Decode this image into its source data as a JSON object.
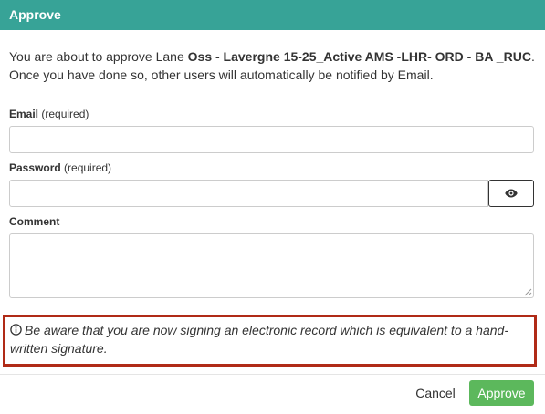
{
  "dialog": {
    "title": "Approve",
    "intro": {
      "before": "You are about to approve Lane ",
      "lane": "Oss - Lavergne 15-25_Active AMS -LHR- ORD - BA _RUC",
      "after": ". Once you have done so, other users will automatically be notified by Email."
    },
    "email": {
      "label": "Email",
      "hint": " (required)",
      "value": "",
      "placeholder": ""
    },
    "password": {
      "label": "Password",
      "hint": " (required)",
      "value": "",
      "placeholder": "",
      "toggle_icon": "eye-icon"
    },
    "comment": {
      "label": "Comment",
      "value": "",
      "placeholder": ""
    },
    "warning": {
      "icon": "info-circle-icon",
      "text": "Be aware that you are now signing an electronic record which is equivalent to a hand-written signature."
    },
    "footer": {
      "cancel_label": "Cancel",
      "approve_label": "Approve"
    }
  },
  "colors": {
    "header": "#37a397",
    "approve_button": "#5cb85c",
    "warning_border": "#b02a17"
  }
}
